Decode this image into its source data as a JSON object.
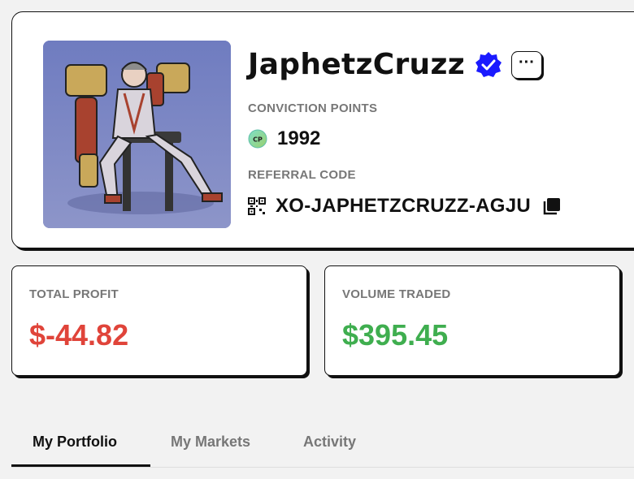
{
  "profile": {
    "username": "JaphetzCruzz",
    "more_label": "···",
    "conviction_label": "CONVICTION POINTS",
    "conviction_value": "1992",
    "cp_icon_text": "CP",
    "referral_label": "REFERRAL CODE",
    "referral_value": "XO-JAPHETZCRUZZ-AGJU"
  },
  "stats": {
    "profit_label": "TOTAL PROFIT",
    "profit_value": "$-44.82",
    "volume_label": "VOLUME TRADED",
    "volume_value": "$395.45"
  },
  "tabs": [
    {
      "label": "My Portfolio",
      "active": true
    },
    {
      "label": "My Markets",
      "active": false
    },
    {
      "label": "Activity",
      "active": false
    }
  ],
  "colors": {
    "verified": "#1a1aff",
    "loss": "#e0443a",
    "gain": "#3fae4f",
    "accent_dark": "#111111"
  }
}
